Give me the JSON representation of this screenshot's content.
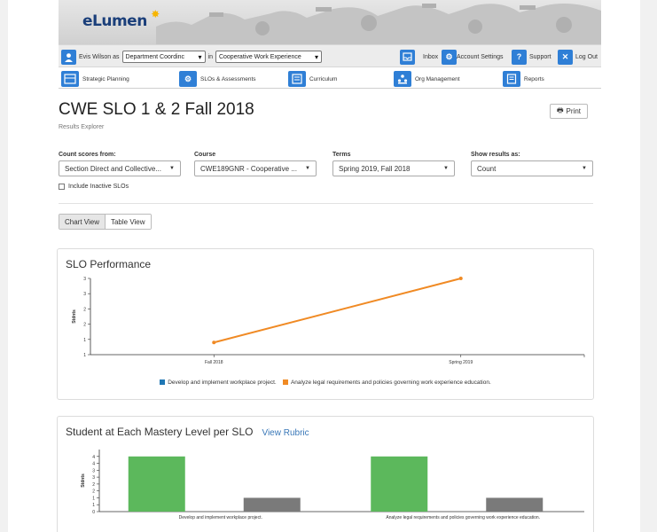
{
  "brand": {
    "logo_text": "eLumen"
  },
  "userbar": {
    "user_name": "Evis Wilson as",
    "role_select": "Department Coordinc",
    "in_label": "in",
    "dept_select": "Cooperative Work Experience",
    "inbox": "Inbox",
    "account_settings": "Account Settings",
    "support": "Support",
    "logout": "Log Out"
  },
  "nav": {
    "items": [
      {
        "label": "Strategic Planning",
        "icon": "strategic-planning-icon"
      },
      {
        "label": "SLOs & Assessments",
        "icon": "slo-assessments-icon"
      },
      {
        "label": "Curriculum",
        "icon": "curriculum-icon"
      },
      {
        "label": "Org Management",
        "icon": "org-management-icon"
      },
      {
        "label": "Reports",
        "icon": "reports-icon"
      }
    ]
  },
  "page": {
    "title": "CWE SLO 1 & 2 Fall 2018",
    "subtitle": "Results Explorer",
    "print": "Print"
  },
  "filters": {
    "count_from": {
      "label": "Count scores from:",
      "value": "Section Direct and Collective..."
    },
    "course": {
      "label": "Course",
      "value": "CWE189GNR - Cooperative ..."
    },
    "terms": {
      "label": "Terms",
      "value": "Spring 2019, Fall 2018"
    },
    "show_as": {
      "label": "Show results as:",
      "value": "Count"
    },
    "inactive_label": "Include Inactive SLOs"
  },
  "views": {
    "chart": "Chart View",
    "table": "Table View"
  },
  "colors": {
    "blue": "#1f77b4",
    "orange": "#f08a24",
    "green": "#5cb85c",
    "gray": "#7a7a7a"
  },
  "chart_data": [
    {
      "type": "line",
      "title": "SLO Performance",
      "ylabel": "Stdnts",
      "x": [
        "Fall 2018",
        "Spring 2019"
      ],
      "ylim": [
        1,
        3.5
      ],
      "yticks": [
        "1",
        "1",
        "2",
        "2",
        "3",
        "3"
      ],
      "ytick_values": [
        1,
        1.5,
        2,
        2.5,
        3,
        3.5
      ],
      "series": [
        {
          "name": "Develop and implement workplace project.",
          "color": "#1f77b4",
          "values": []
        },
        {
          "name": "Analyze legal requirements and policies governing work experience education.",
          "color": "#f08a24",
          "values": [
            1.4,
            3.5
          ]
        }
      ],
      "legend": "bottom"
    },
    {
      "type": "bar",
      "title": "Student at Each Mastery Level per SLO",
      "link": "View Rubric",
      "ylabel": "Stdnts",
      "categories": [
        "Develop and implement workplace project.",
        "Analyze legal requirements and policies governing work experience education."
      ],
      "ylim": [
        0,
        4.5
      ],
      "yticks": [
        "0",
        "1",
        "1",
        "2",
        "2",
        "3",
        "3",
        "4",
        "4"
      ],
      "ytick_values": [
        0,
        0.5,
        1,
        1.5,
        2,
        2.5,
        3,
        3.5,
        4
      ],
      "series": [
        {
          "color": "#5cb85c",
          "values": [
            4,
            4
          ]
        },
        {
          "color": "#7a7a7a",
          "values": [
            1,
            1
          ]
        }
      ]
    }
  ]
}
